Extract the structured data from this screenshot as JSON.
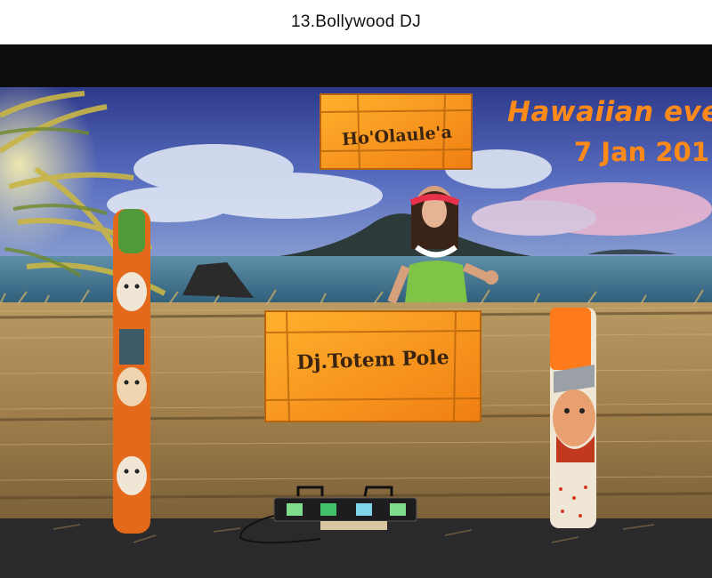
{
  "caption": "13.Bollywood DJ",
  "banner": {
    "title": "Hawaiian eve",
    "date": "7 Jan 201"
  },
  "signs": {
    "top": "Ho'Olaule'a",
    "main": "Dj.Totem Pole"
  },
  "colors": {
    "banner_text": "#ff8a1a",
    "sign_wood": "#f5a623",
    "sky": "#3b4a9a",
    "straw": "#a98a55"
  }
}
